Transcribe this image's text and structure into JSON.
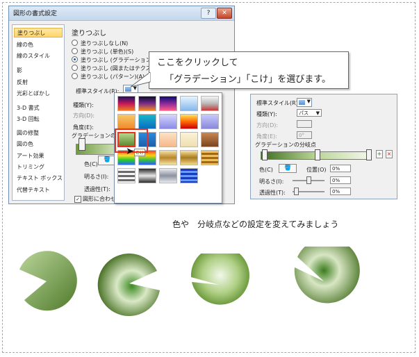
{
  "dialog": {
    "title": "図形の書式設定",
    "help_label": "?",
    "close_label": "✕",
    "nav": [
      "塗りつぶし",
      "線の色",
      "線のスタイル",
      "影",
      "反射",
      "光彩とぼかし",
      "3-D 書式",
      "3-D 回転",
      "図の修整",
      "図の色",
      "アート効果",
      "トリミング",
      "テキスト ボックス",
      "代替テキスト"
    ],
    "section_title": "塗りつぶし",
    "fill_options": [
      "塗りつぶしなし(N)",
      "塗りつぶし (単色)(S)",
      "塗りつぶし (グラデーション)(G)",
      "塗りつぶし (図またはテクスチャ)(P)",
      "塗りつぶし (パターン)(A)"
    ],
    "preset_label": "標準スタイル(R):",
    "type_label": "種類(Y):",
    "direction_label": "方向(D):",
    "angle_label": "角度(E):",
    "gradient_stops_label": "グラデーションの分岐点",
    "color_label": "色(C)",
    "brightness_label": "明るさ(I):",
    "transparency_label": "透過性(T):",
    "rotate_checkbox_label": "図形に合わせて回転する(W)"
  },
  "popup": {
    "selected_label": "こけ"
  },
  "callout": {
    "line1": "ここをクリックして",
    "line2": "「グラデーション」「こけ」を選びます。"
  },
  "dialog2": {
    "preset_label": "標準スタイル(R):",
    "type_label": "種類(Y):",
    "type_value": "パス",
    "direction_label": "方向(D):",
    "angle_label": "角度(E):",
    "angle_value": "0°",
    "gradient_stops_label": "グラデーションの分岐点",
    "color_label": "色(C)",
    "position_label": "位置(O)",
    "position_value": "0%",
    "brightness_label": "明るさ(I):",
    "brightness_value": "0%",
    "transparency_label": "透過性(T):",
    "transparency_value": "0%"
  },
  "caption": "色や　分岐点などの設定を変えてみましょう",
  "colors": {
    "accent_red": "#e53322",
    "moss_dark": "#4f7a2a",
    "moss_light": "#d4e5bc"
  }
}
